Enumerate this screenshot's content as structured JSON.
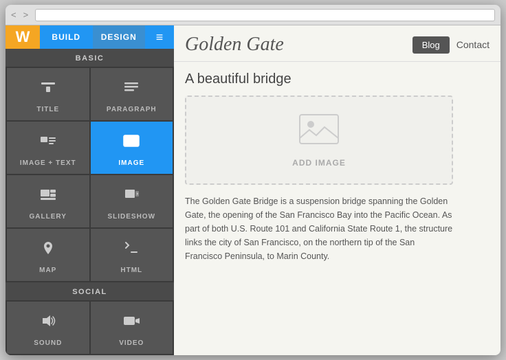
{
  "browser": {
    "arrows": "< >"
  },
  "topbar": {
    "logo": "W",
    "tab_build": "BUILD",
    "tab_design": "DESIGN",
    "menu_icon": "≡"
  },
  "left_panel": {
    "section_basic": "BASIC",
    "section_social": "SOCIAL",
    "widgets": [
      {
        "id": "title",
        "label": "TITLE",
        "icon": "title"
      },
      {
        "id": "paragraph",
        "label": "PARAGRAPH",
        "icon": "paragraph"
      },
      {
        "id": "image-text",
        "label": "IMAGE + TEXT",
        "icon": "image-text"
      },
      {
        "id": "image",
        "label": "IMAGE",
        "icon": "image",
        "active": true
      },
      {
        "id": "gallery",
        "label": "GALLERY",
        "icon": "gallery"
      },
      {
        "id": "slideshow",
        "label": "SLIDESHOW",
        "icon": "slideshow"
      },
      {
        "id": "map",
        "label": "MAP",
        "icon": "map"
      },
      {
        "id": "html",
        "label": "HTML",
        "icon": "html"
      }
    ],
    "social_widgets": [
      {
        "id": "sound",
        "label": "SOUND",
        "icon": "sound"
      },
      {
        "id": "video",
        "label": "VIDEO",
        "icon": "video"
      }
    ]
  },
  "right_panel": {
    "site_title": "Golden Gate",
    "nav_blog": "Blog",
    "nav_contact": "Contact",
    "page_heading": "A beautiful bridge",
    "image_add_text": "ADD IMAGE",
    "body_text": "The Golden Gate Bridge is a suspension bridge spanning the Golden Gate, the opening of the San Francisco Bay into the Pacific Ocean. As part of both U.S. Route 101 and California State Route 1, the structure links the city of San Francisco, on the northern tip of the San Francisco Peninsula, to Marin County."
  }
}
